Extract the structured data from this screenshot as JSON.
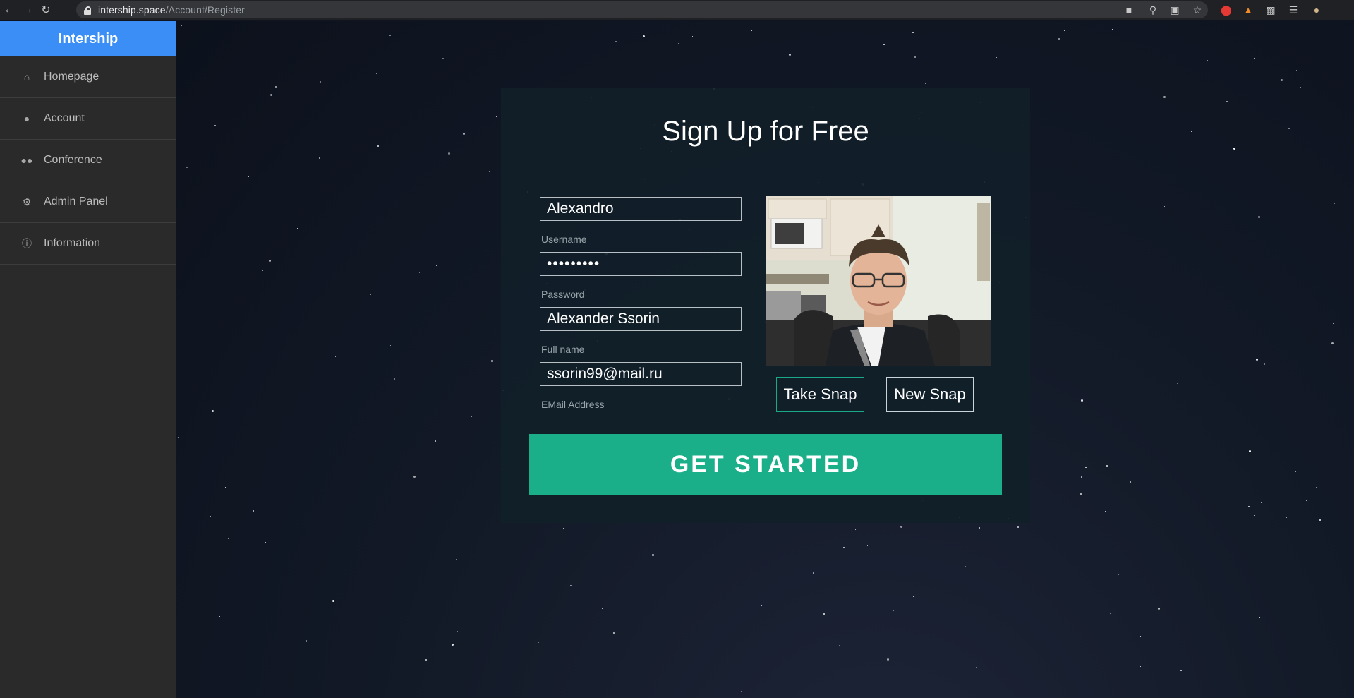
{
  "browser": {
    "url_host": "intership.space",
    "url_path": "/Account/Register"
  },
  "sidebar": {
    "brand": "Intership",
    "items": [
      {
        "label": "Homepage",
        "icon": "home-icon"
      },
      {
        "label": "Account",
        "icon": "user-icon"
      },
      {
        "label": "Conference",
        "icon": "users-icon"
      },
      {
        "label": "Admin Panel",
        "icon": "gear-icon"
      },
      {
        "label": "Information",
        "icon": "info-icon"
      }
    ]
  },
  "form": {
    "title": "Sign Up for Free",
    "username": {
      "value": "Alexandro",
      "label": "Username"
    },
    "password": {
      "value": "•••••••••",
      "label": "Password"
    },
    "fullname": {
      "value": "Alexander Ssorin",
      "label": "Full name"
    },
    "email": {
      "value": "ssorin99@mail.ru",
      "label": "EMail Address"
    },
    "take_snap": "Take Snap",
    "new_snap": "New Snap",
    "submit": "GET STARTED"
  },
  "colors": {
    "brand": "#3a8ef6",
    "accent": "#1aaf89",
    "sidebar": "#2a2a2a"
  }
}
